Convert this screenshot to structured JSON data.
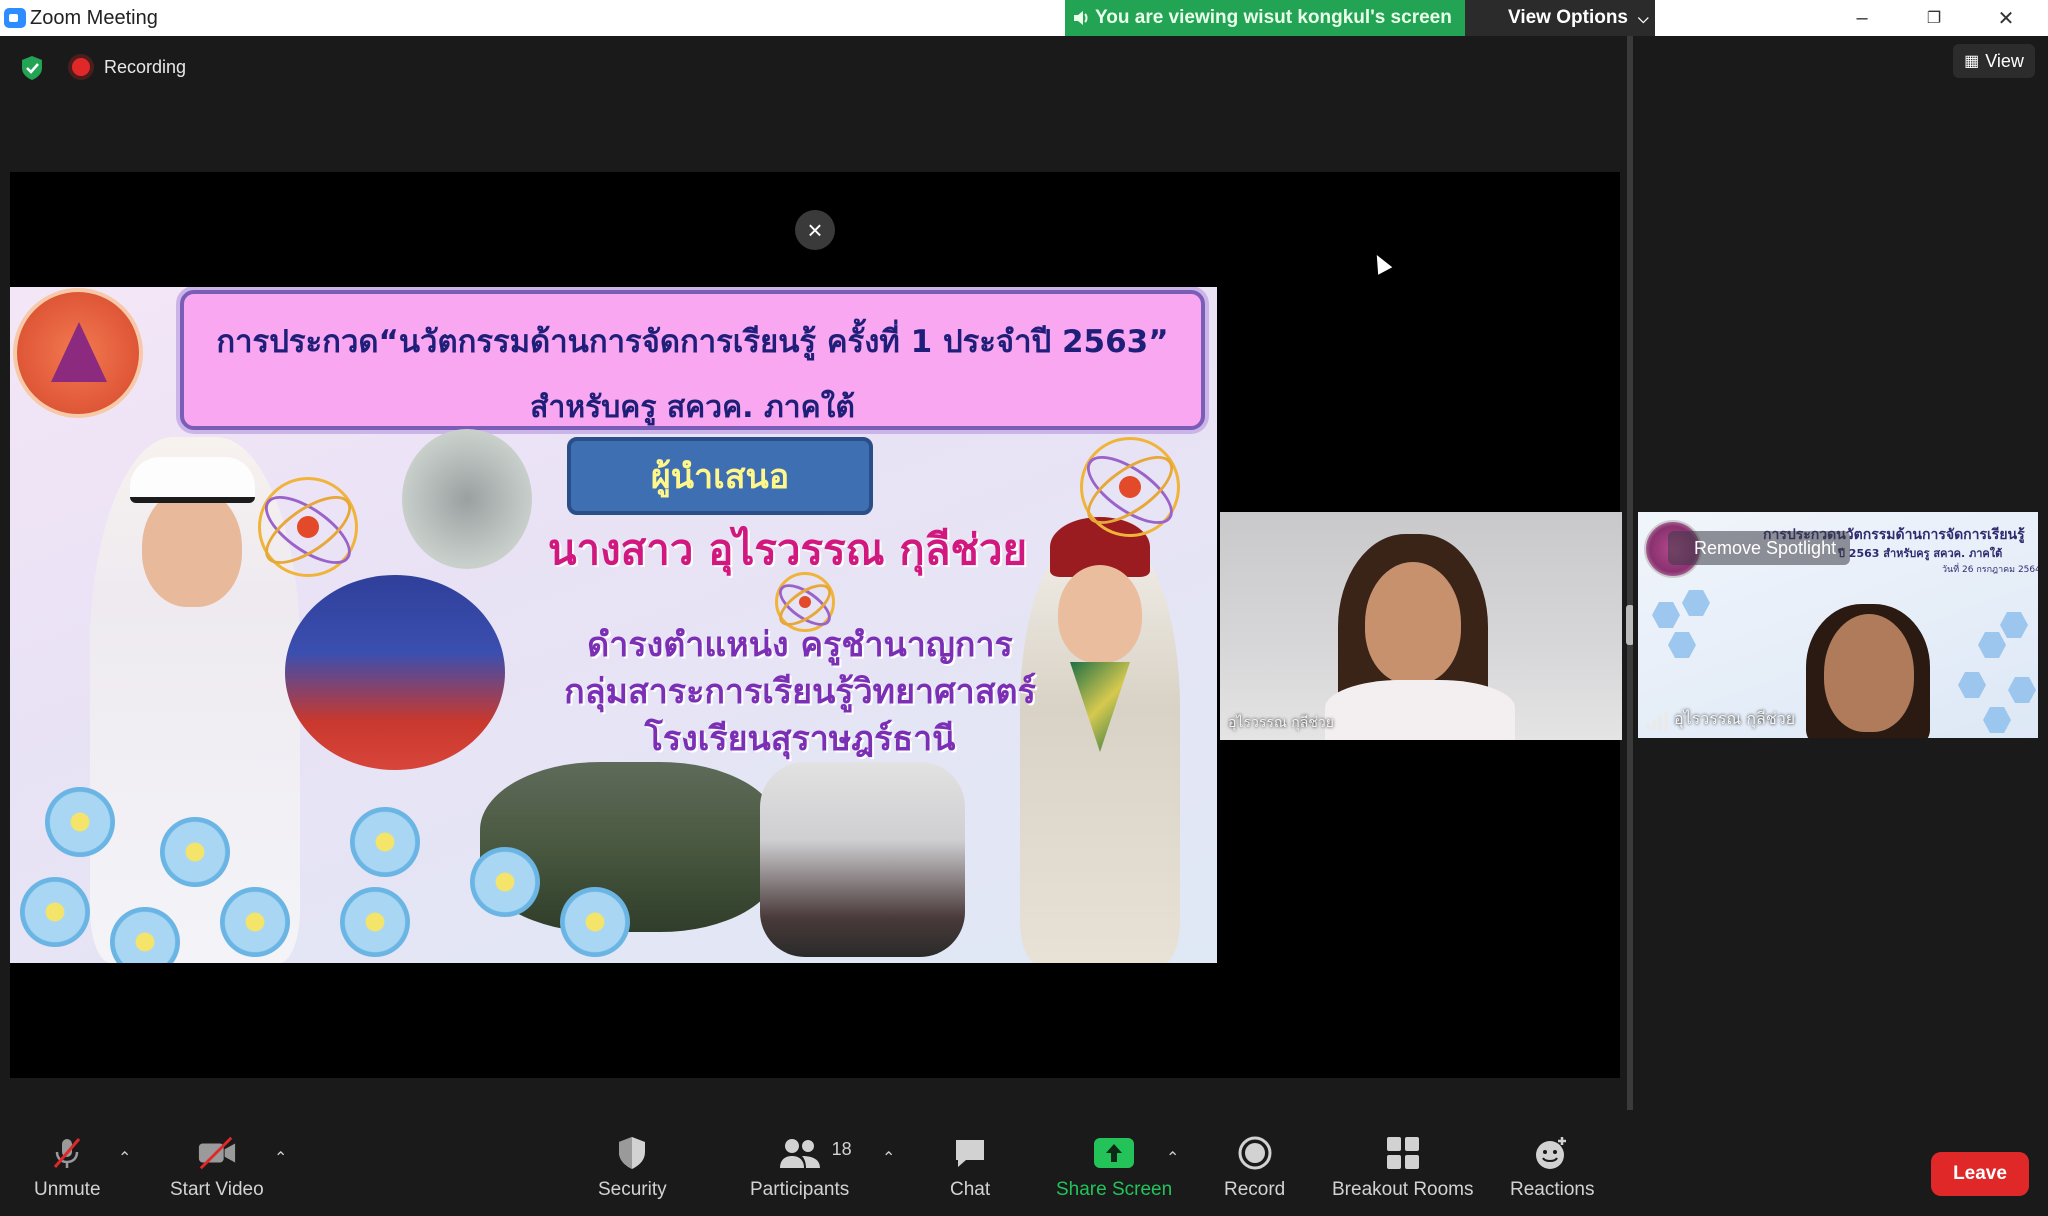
{
  "window": {
    "title": "Zoom Meeting"
  },
  "banner": {
    "viewing_text": "You are viewing wisut kongkul's screen",
    "view_options_label": "View Options"
  },
  "status": {
    "recording_label": "Recording"
  },
  "right_panel": {
    "view_button_label": "View",
    "spotlight": {
      "remove_label": "Remove Spotlight",
      "participant_name": "อุไรวรรณ กุลีช่วย",
      "slide_line1": "การประกวดนวัตกรรมด้านการจัดการเรียนรู้",
      "slide_line2": "ปี 2563 สำหรับครู สควค. ภาคใต้",
      "slide_line3": "วันที่ 26 กรกฎาคม 2564"
    }
  },
  "video_tile": {
    "name": "อุไรวรรณ กุลีช่วย"
  },
  "slide": {
    "title_line1": "การประกวด“นวัตกรรมด้านการจัดการเรียนรู้ ครั้งที่ 1 ประจำปี 2563”",
    "title_line2": "สำหรับครู สควค. ภาคใต้",
    "presenter_tag": "ผู้นำเสนอ",
    "presenter_name": "นางสาว อุไรวรรณ กุลีช่วย",
    "position_line1": "ดำรงตำแหน่ง ครูชำนาญการ",
    "position_line2": "กลุ่มสาระการเรียนรู้วิทยาศาสตร์",
    "position_line3": "โรงเรียนสุราษฎร์ธานี"
  },
  "toolbar": {
    "unmute": "Unmute",
    "start_video": "Start Video",
    "security": "Security",
    "participants": "Participants",
    "participants_count": "18",
    "chat": "Chat",
    "share_screen": "Share Screen",
    "record": "Record",
    "breakout_rooms": "Breakout Rooms",
    "reactions": "Reactions",
    "leave": "Leave"
  },
  "colors": {
    "banner_green": "#23a455",
    "leave_red": "#e02828",
    "share_green": "#23c35a",
    "recording_red": "#e02828"
  }
}
